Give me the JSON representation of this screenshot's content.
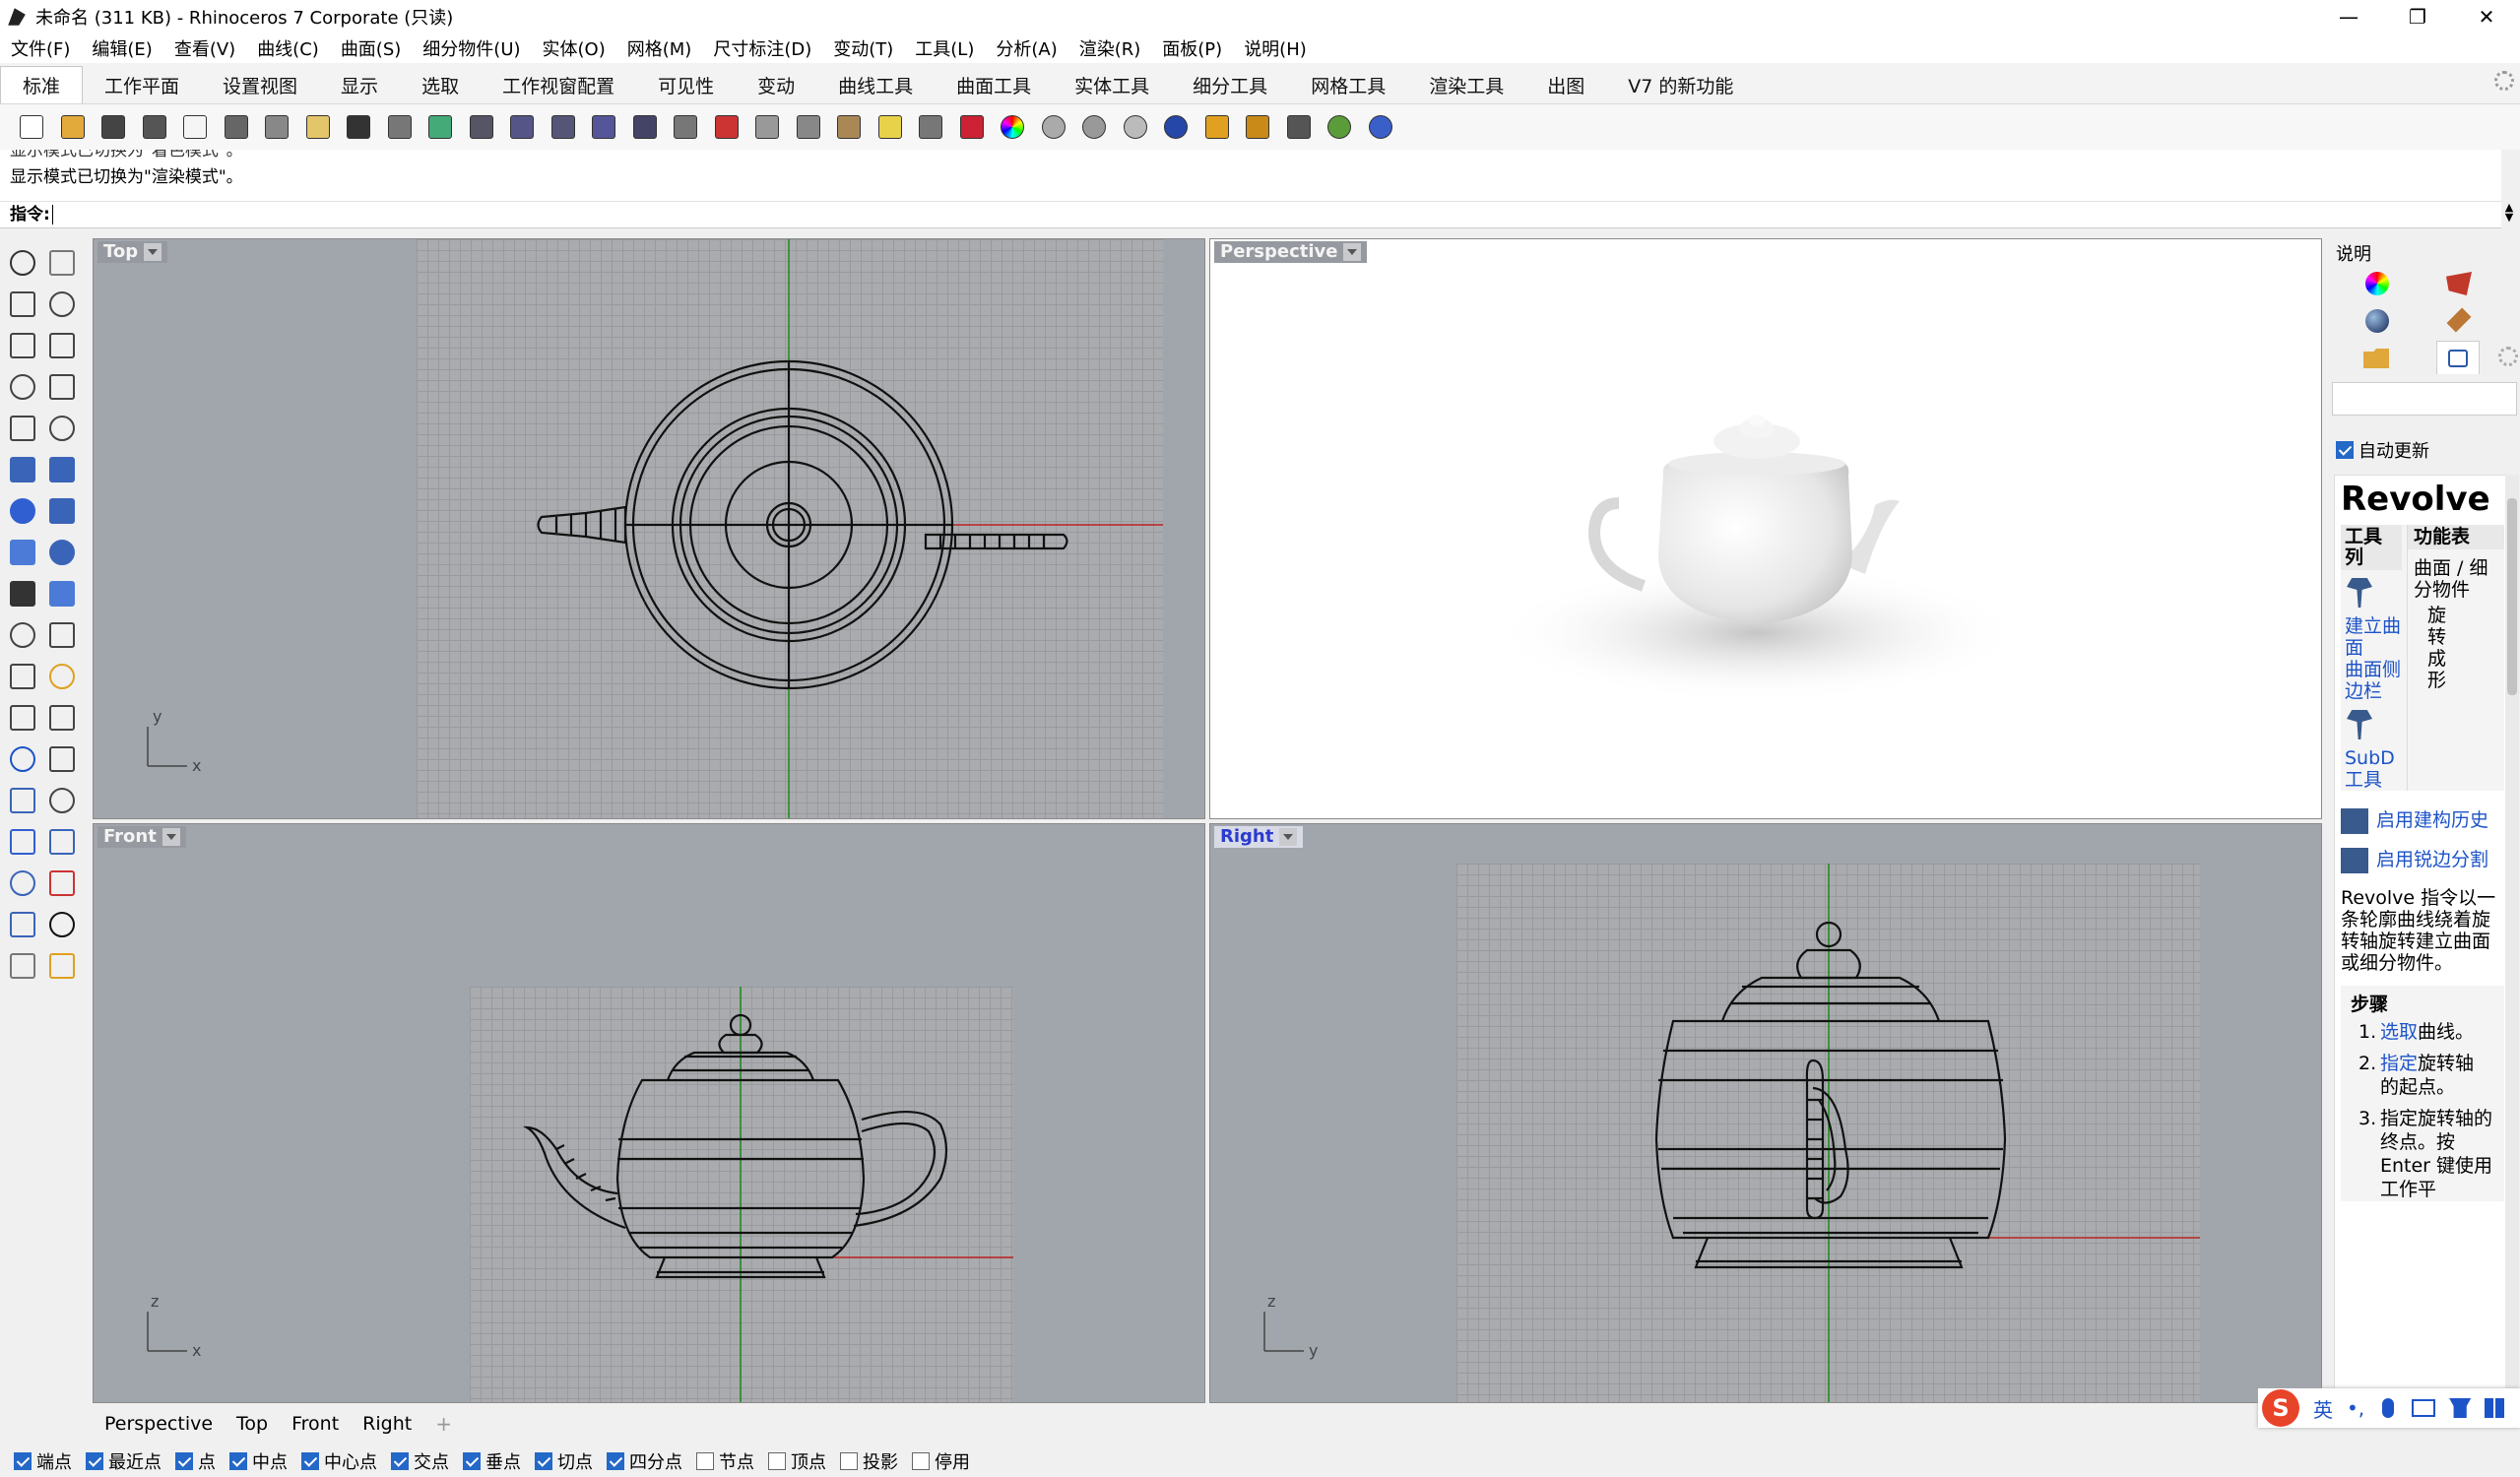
{
  "window": {
    "title": "未命名 (311 KB) - Rhinoceros 7 Corporate (只读)",
    "minimize": "—",
    "maximize": "❐",
    "close": "✕"
  },
  "menu": [
    "文件(F)",
    "编辑(E)",
    "查看(V)",
    "曲线(C)",
    "曲面(S)",
    "细分物件(U)",
    "实体(O)",
    "网格(M)",
    "尺寸标注(D)",
    "变动(T)",
    "工具(L)",
    "分析(A)",
    "渲染(R)",
    "面板(P)",
    "说明(H)"
  ],
  "tabs": [
    "标准",
    "工作平面",
    "设置视图",
    "显示",
    "选取",
    "工作视窗配置",
    "可见性",
    "变动",
    "曲线工具",
    "曲面工具",
    "实体工具",
    "细分工具",
    "网格工具",
    "渲染工具",
    "出图",
    "V7 的新功能"
  ],
  "toolbar_icons": [
    "new-icon",
    "open-icon",
    "save-icon",
    "print-icon",
    "import-icon",
    "cut-icon",
    "copy-icon",
    "paste-icon",
    "undo-icon",
    "pan-icon",
    "rotate-view-icon",
    "zoom-icon",
    "zoom-window-icon",
    "zoom-extents-icon",
    "zoom-selected-icon",
    "rotate-camera-icon",
    "four-viewports-icon",
    "car-icon",
    "grid-icon",
    "options-icon",
    "snap-icon",
    "light-icon",
    "lock-icon",
    "material-icon",
    "color-wheel-icon",
    "sphere-wire-icon",
    "sphere-shaded-icon",
    "sphere-render-icon",
    "sphere-blue-icon",
    "filter-icon",
    "gear-icon",
    "select-icon",
    "globe-icon",
    "help-icon"
  ],
  "command": {
    "history": [
      "显示模式已切换为\"着色模式\"。",
      "显示模式已切换为\"渲染模式\"。"
    ],
    "prompt": "指令:"
  },
  "viewports": {
    "top": "Top",
    "perspective": "Perspective",
    "front": "Front",
    "right": "Right"
  },
  "axes": {
    "x": "x",
    "y": "y",
    "z": "z"
  },
  "view_tabs": [
    "Perspective",
    "Top",
    "Front",
    "Right"
  ],
  "osnaps": [
    {
      "label": "端点",
      "on": true
    },
    {
      "label": "最近点",
      "on": true
    },
    {
      "label": "点",
      "on": true
    },
    {
      "label": "中点",
      "on": true
    },
    {
      "label": "中心点",
      "on": true
    },
    {
      "label": "交点",
      "on": true
    },
    {
      "label": "垂点",
      "on": true
    },
    {
      "label": "切点",
      "on": true
    },
    {
      "label": "四分点",
      "on": true
    },
    {
      "label": "节点",
      "on": false
    },
    {
      "label": "顶点",
      "on": false
    },
    {
      "label": "投影",
      "on": false
    },
    {
      "label": "停用",
      "on": false
    }
  ],
  "panel": {
    "title": "说明",
    "auto_update": "自动更新",
    "command_name": "Revolve",
    "col_tools": "工具列",
    "col_function": "功能表",
    "function_text": "曲面 / 细分物件",
    "function_sub": "旋转成形",
    "link1": "建立曲面",
    "link2": "曲面侧边栏",
    "link3": "SubD 工具",
    "history_link": "启用建构历史",
    "crease_link": "启用锐边分割",
    "description": "Revolve 指令以一条轮廓曲线绕着旋转轴旋转建立曲面或细分物件。",
    "steps_title": "步骤",
    "steps": [
      {
        "link": "选取",
        "text": "曲线。"
      },
      {
        "link": "指定",
        "text": "旋转轴的起点。"
      },
      {
        "link": "",
        "text": "指定旋转轴的终点。按 Enter 键使用工作平"
      }
    ]
  },
  "ime": {
    "logo": "S",
    "lang": "英",
    "punct": "•,"
  }
}
